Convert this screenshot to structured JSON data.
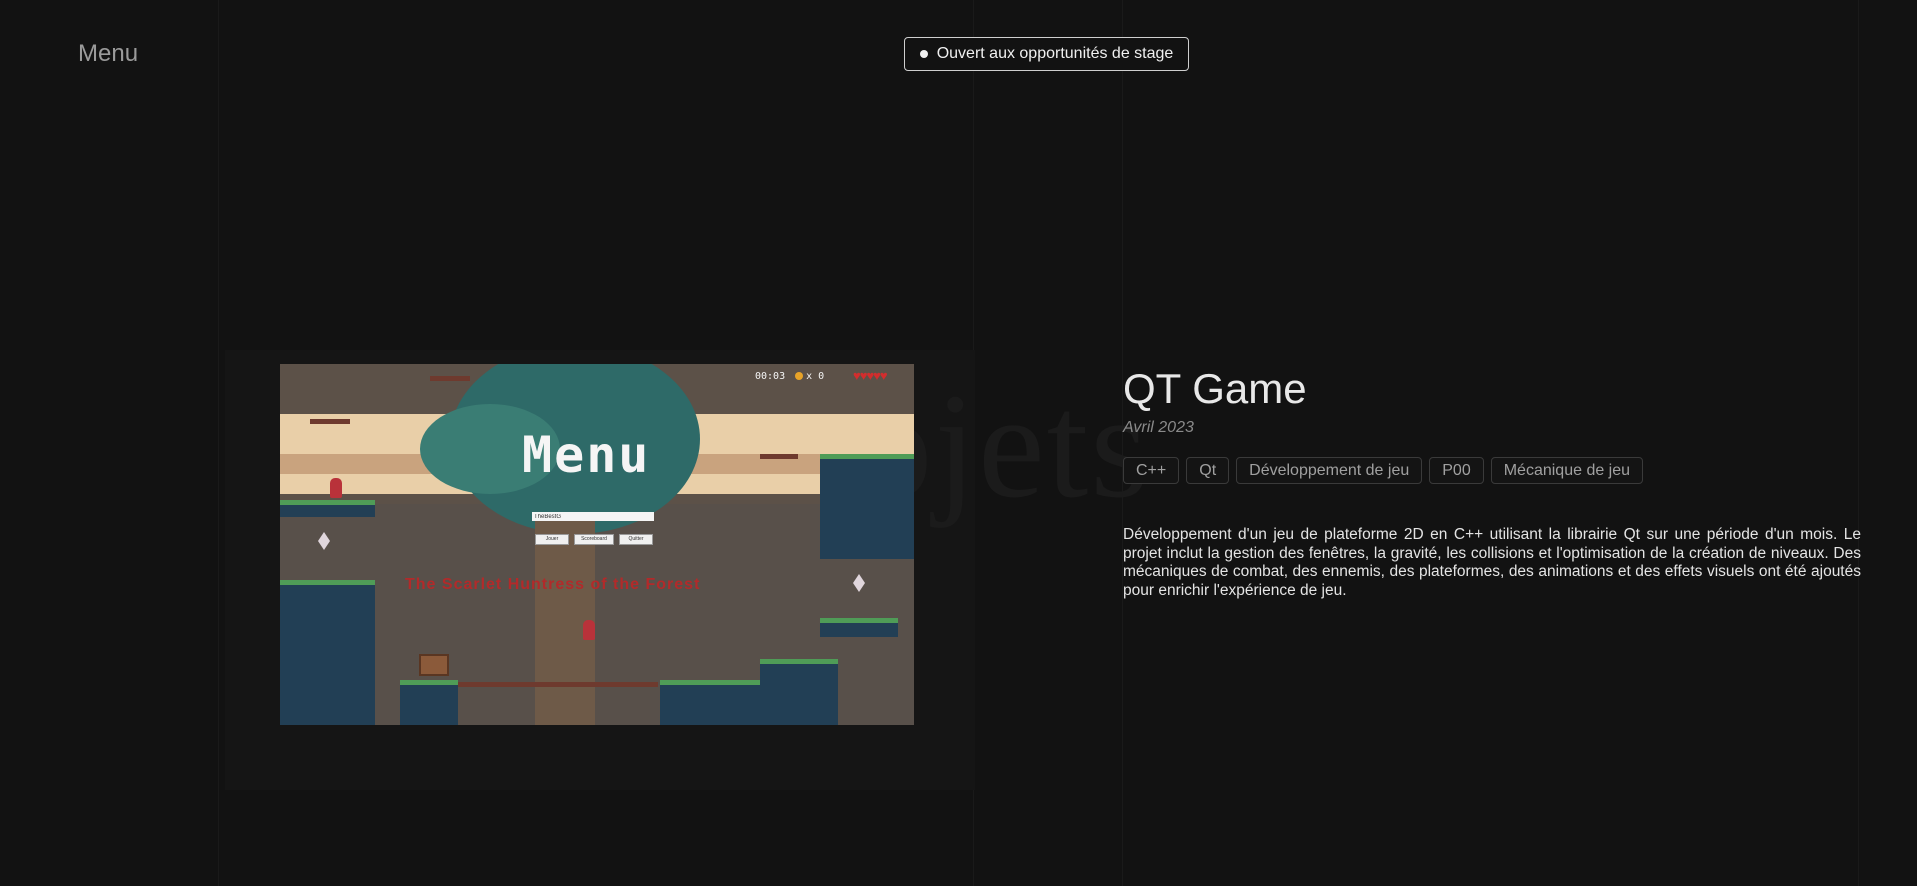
{
  "nav": {
    "menu_label": "Menu"
  },
  "badge": {
    "label": "Ouvert aux opportunités de stage"
  },
  "background": {
    "word": "Projets"
  },
  "project": {
    "title": "QT Game",
    "date": "Avril 2023",
    "tags": [
      "C++",
      "Qt",
      "Développement de jeu",
      "P00",
      "Mécanique de jeu"
    ],
    "description": "Développement d'un jeu de plateforme 2D en C++ utilisant la librairie Qt sur une période d'un mois. Le projet inclut la gestion des fenêtres, la gravité, les collisions et l'optimisation de la création de niveaux. Des mécaniques de combat, des ennemis, des plateformes, des animations et des effets visuels ont été ajoutés pour enrichir l'expérience de jeu."
  },
  "game_screenshot": {
    "hud_time": "00:03",
    "hud_coins": "x 0",
    "hearts": "♥♥♥♥♥",
    "menu_title": "Menu",
    "name_value": "TheBestG",
    "buttons": [
      "Jouer",
      "Scoreboard",
      "Quitter"
    ],
    "subtitle": "The Scarlet Huntress of the Forest"
  },
  "colors": {
    "background": "#121212",
    "text": "#e6e6e6",
    "muted": "#9a9a9a",
    "tag_border": "#3a3a3a"
  }
}
